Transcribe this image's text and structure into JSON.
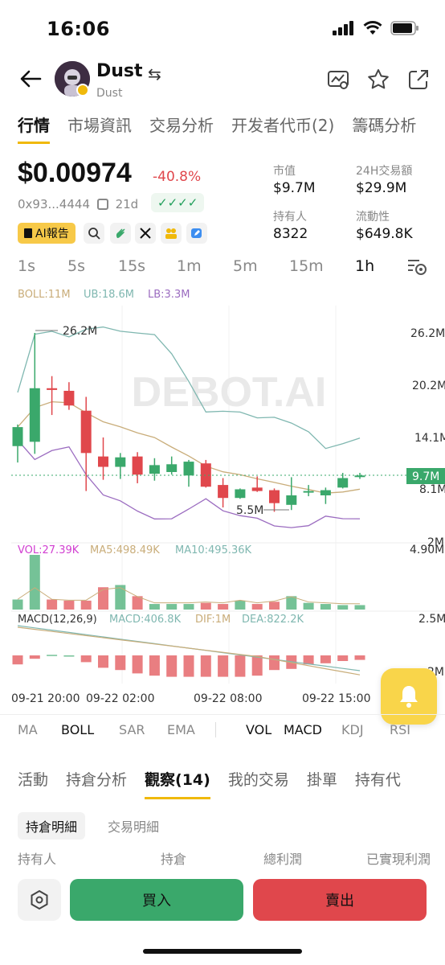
{
  "status": {
    "time": "16:06"
  },
  "header": {
    "name": "Dust",
    "subtitle": "Dust",
    "swap_icon": "⇆"
  },
  "tabs": [
    "行情",
    "市場資訊",
    "交易分析",
    "开发者代币(2)",
    "籌碼分析"
  ],
  "price": {
    "value": "$0.00974",
    "change": "-40.8%",
    "address": "0x93...4444",
    "age": "21d",
    "checks": "✓✓✓✓",
    "ai_label": "AI報告"
  },
  "stats": {
    "market_cap_label": "市值",
    "market_cap": "$9.7M",
    "volume_label": "24H交易額",
    "volume": "$29.9M",
    "holders_label": "持有人",
    "holders": "8322",
    "liquidity_label": "流動性",
    "liquidity": "$649.8K"
  },
  "timeframes": [
    "1s",
    "5s",
    "15s",
    "1m",
    "5m",
    "15m",
    "1h"
  ],
  "chart": {
    "watermark": "DEBOT.AI",
    "boll": "BOLL:11M",
    "ub": "UB:18.6M",
    "lb": "LB:3.3M",
    "high_label": "26.2M",
    "low_label": "5.5M",
    "y_ticks": [
      "26.2M",
      "20.2M",
      "14.1M",
      "8.1M",
      "2M"
    ],
    "current": "9.7M",
    "vol": "VOL:27.39K",
    "ma5": "MA5:498.49K",
    "ma10": "MA10:495.36K",
    "vol_max": "4.90M",
    "macd_title": "MACD(12,26,9)",
    "macd": "MACD:406.8K",
    "dif": "DIF:1M",
    "dea": "DEA:822.2K",
    "macd_top": "2.5M",
    "macd_bot": "2M",
    "x_ticks": [
      "09-21 20:00",
      "09-22 02:00",
      "09-22 08:00",
      "09-22 15:00"
    ],
    "colors": {
      "up": "#3aa86b",
      "down": "#e0474c",
      "ub": "#7fb7b0",
      "mid": "#c9ad7a",
      "lb": "#9b6cc0"
    }
  },
  "chart_data": {
    "type": "candlestick",
    "x_ticks": [
      "09-21 20:00",
      "09-22 02:00",
      "09-22 08:00",
      "09-22 15:00"
    ],
    "y_ticks": [
      "26.2M",
      "20.2M",
      "14.1M",
      "8.1M",
      "2M"
    ],
    "candles": [
      {
        "o": 13.1,
        "c": 15.3,
        "h": 15.6,
        "l": 11.2
      },
      {
        "o": 13.6,
        "c": 19.8,
        "h": 26.2,
        "l": 12.2
      },
      {
        "o": 19.8,
        "c": 19.6,
        "h": 21.2,
        "l": 16.7
      },
      {
        "o": 19.5,
        "c": 17.8,
        "h": 20.5,
        "l": 17.3
      },
      {
        "o": 17.2,
        "c": 12.3,
        "h": 18.8,
        "l": 7.9
      },
      {
        "o": 11.9,
        "c": 10.7,
        "h": 14.1,
        "l": 9.2
      },
      {
        "o": 10.7,
        "c": 11.8,
        "h": 12.3,
        "l": 9.3
      },
      {
        "o": 11.9,
        "c": 9.8,
        "h": 12.4,
        "l": 8.8
      },
      {
        "o": 9.9,
        "c": 10.9,
        "h": 11.7,
        "l": 9.1
      },
      {
        "o": 10.1,
        "c": 11.0,
        "h": 11.9,
        "l": 9.8
      },
      {
        "o": 9.7,
        "c": 11.3,
        "h": 11.5,
        "l": 8.4
      },
      {
        "o": 11.1,
        "c": 8.4,
        "h": 11.5,
        "l": 8.3
      },
      {
        "o": 8.6,
        "c": 7.1,
        "h": 9.4,
        "l": 6.0
      },
      {
        "o": 7.1,
        "c": 8.1,
        "h": 8.2,
        "l": 7.0
      },
      {
        "o": 8.3,
        "c": 7.9,
        "h": 9.6,
        "l": 7.8
      },
      {
        "o": 8.0,
        "c": 6.5,
        "h": 8.2,
        "l": 5.5
      },
      {
        "o": 6.3,
        "c": 7.4,
        "h": 9.5,
        "l": 5.7
      },
      {
        "o": 7.8,
        "c": 7.9,
        "h": 8.6,
        "l": 7.3
      },
      {
        "o": 7.4,
        "c": 8.0,
        "h": 8.3,
        "l": 6.4
      },
      {
        "o": 8.3,
        "c": 9.4,
        "h": 10.0,
        "l": 8.2
      },
      {
        "o": 9.6,
        "c": 9.7,
        "h": 10.0,
        "l": 9.3
      }
    ],
    "volume": [
      0.9,
      4.9,
      0.9,
      0.8,
      0.8,
      2.0,
      2.2,
      1.2,
      0.5,
      0.5,
      0.5,
      0.6,
      0.5,
      0.8,
      0.5,
      0.7,
      1.2,
      0.6,
      0.5,
      0.4,
      0.4
    ],
    "macd_hist": [
      -0.8,
      -0.3,
      0.05,
      0.0,
      -0.6,
      -1.1,
      -1.3,
      -1.6,
      -1.8,
      -1.9,
      -1.9,
      -1.9,
      -1.9,
      -1.9,
      -1.8,
      -1.3,
      -1.2,
      -0.8,
      -0.7,
      -0.5,
      -0.4
    ]
  },
  "indicators": [
    "MA",
    "BOLL",
    "SAR",
    "EMA",
    "VOL",
    "MACD",
    "KDJ",
    "RSI"
  ],
  "bottom_tabs": [
    "活動",
    "持倉分析",
    "觀察(14)",
    "我的交易",
    "掛單",
    "持有代"
  ],
  "sub_tabs": [
    "持倉明細",
    "交易明細"
  ],
  "columns": [
    "持有人",
    "持倉",
    "總利潤",
    "已實現利潤"
  ],
  "actions": {
    "buy": "買入",
    "sell": "賣出"
  }
}
